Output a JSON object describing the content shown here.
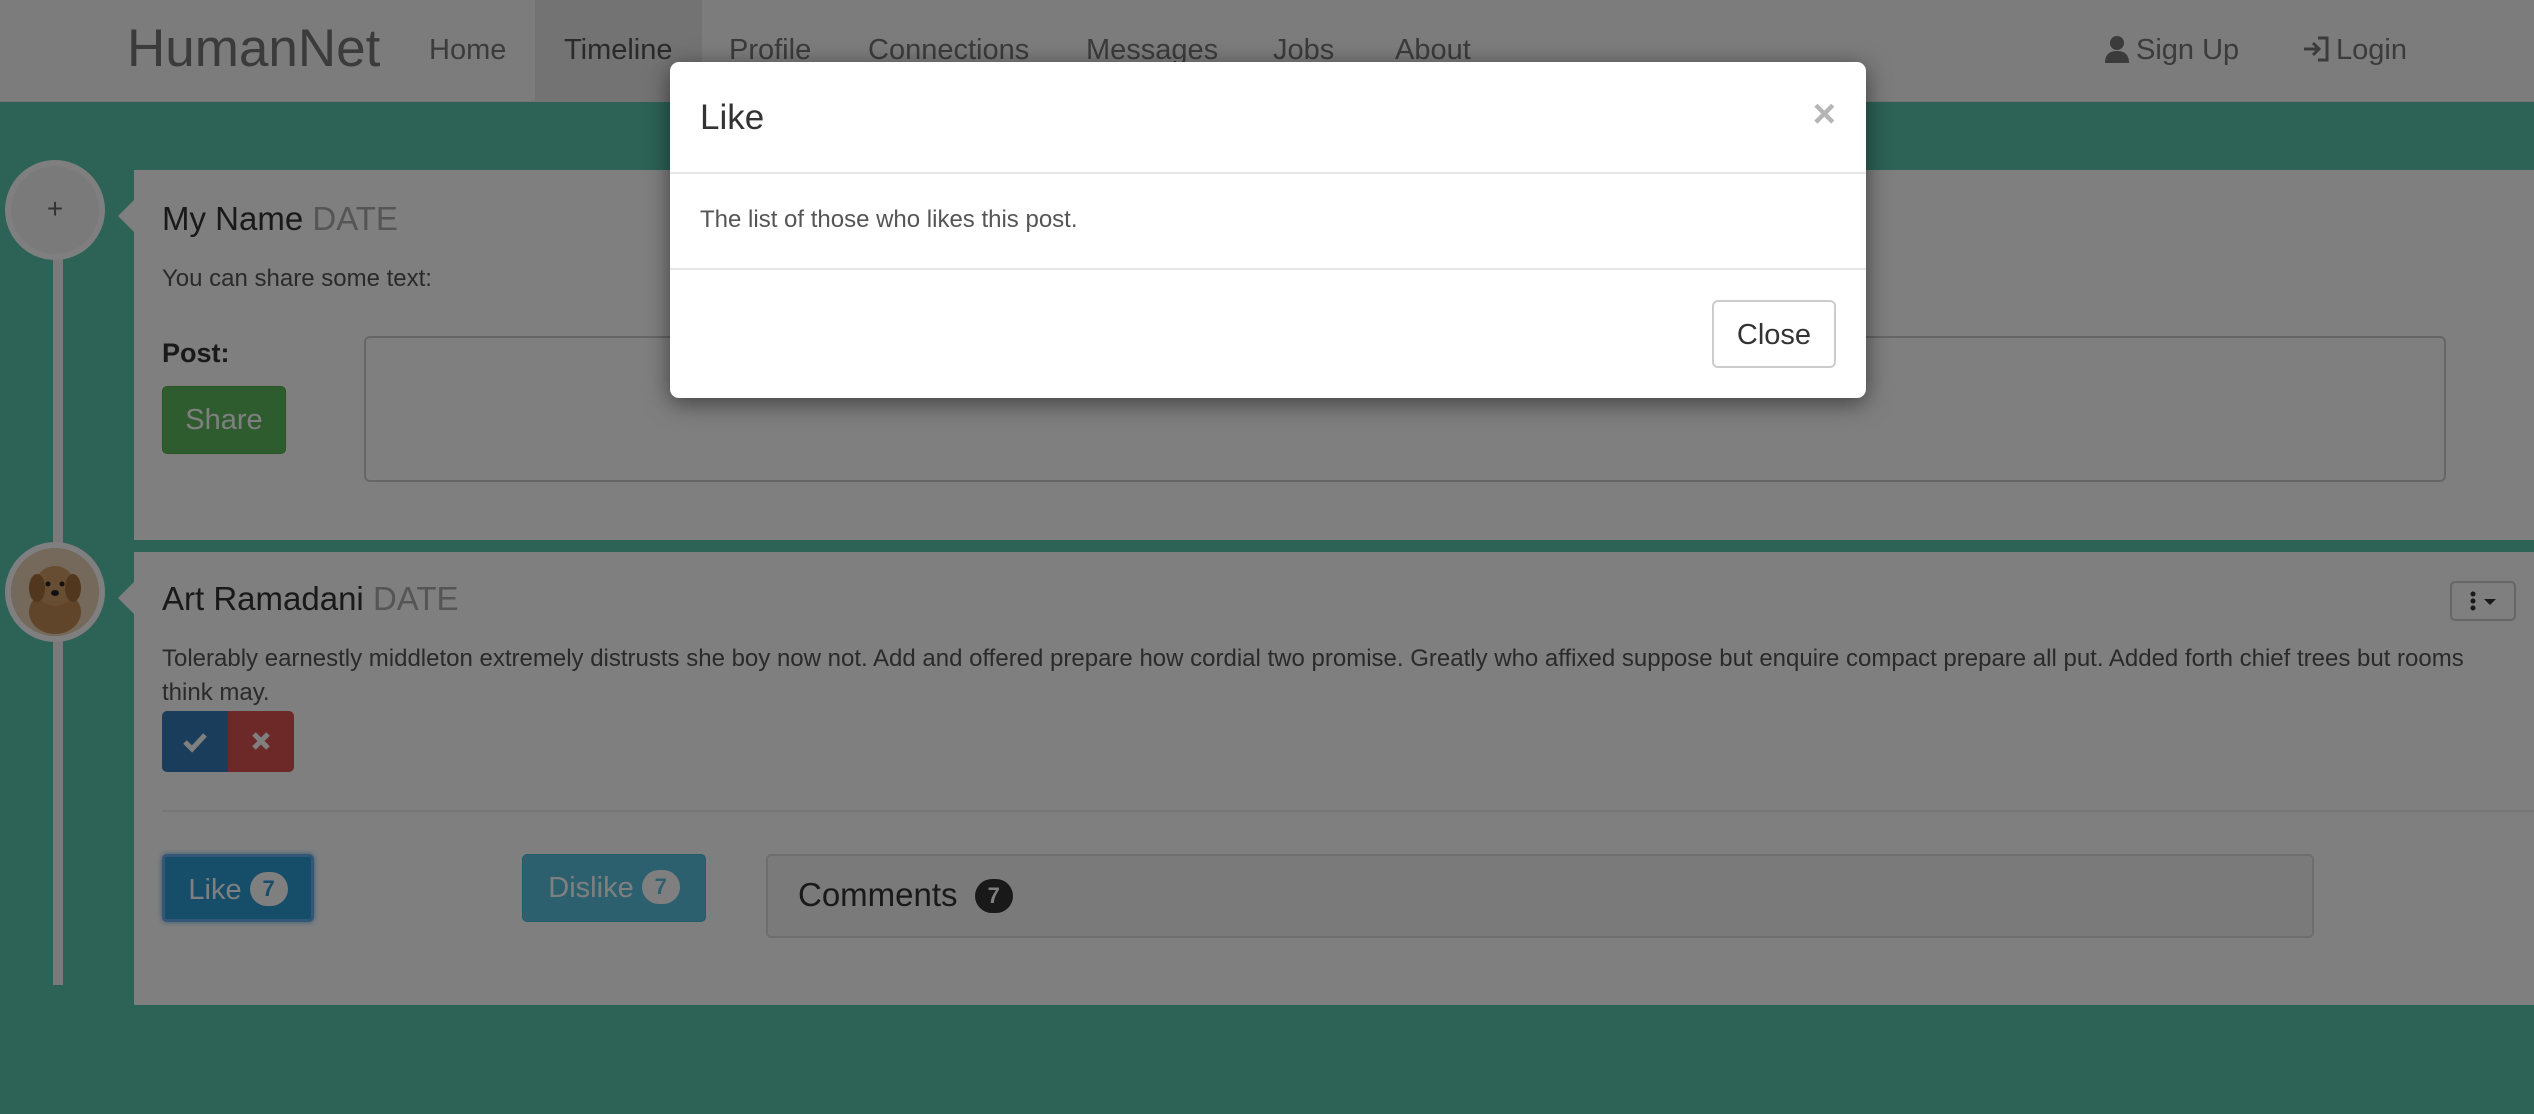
{
  "navbar": {
    "brand": "HumanNet",
    "items": [
      "Home",
      "Timeline",
      "Profile",
      "Connections",
      "Messages",
      "Jobs",
      "About"
    ],
    "active": "Timeline",
    "signup": "Sign Up",
    "login": "Login"
  },
  "compose": {
    "add_symbol": "+",
    "name": "My Name",
    "date": "DATE",
    "prompt": "You can share some text:",
    "post_label": "Post:",
    "share_label": "Share",
    "textarea_value": ""
  },
  "post": {
    "name": "Art Ramadani",
    "date": "DATE",
    "text": "Tolerably earnestly middleton extremely distrusts she boy now not. Add and offered prepare how cordial two promise. Greatly who affixed suppose but enquire compact prepare all put. Added forth chief trees but rooms think may.",
    "like_label": "Like",
    "like_count": "7",
    "dislike_label": "Dislike",
    "dislike_count": "7",
    "comments_label": "Comments",
    "comments_count": "7"
  },
  "modal": {
    "title": "Like",
    "close_x": "×",
    "body": "The list of those who likes this post.",
    "close_label": "Close"
  },
  "colors": {
    "background": "#5ac4ad",
    "share": "#5cb85c",
    "approve": "#337ab7",
    "reject": "#d9534f",
    "like": "#2c9ad2",
    "dislike": "#5bc0de"
  }
}
